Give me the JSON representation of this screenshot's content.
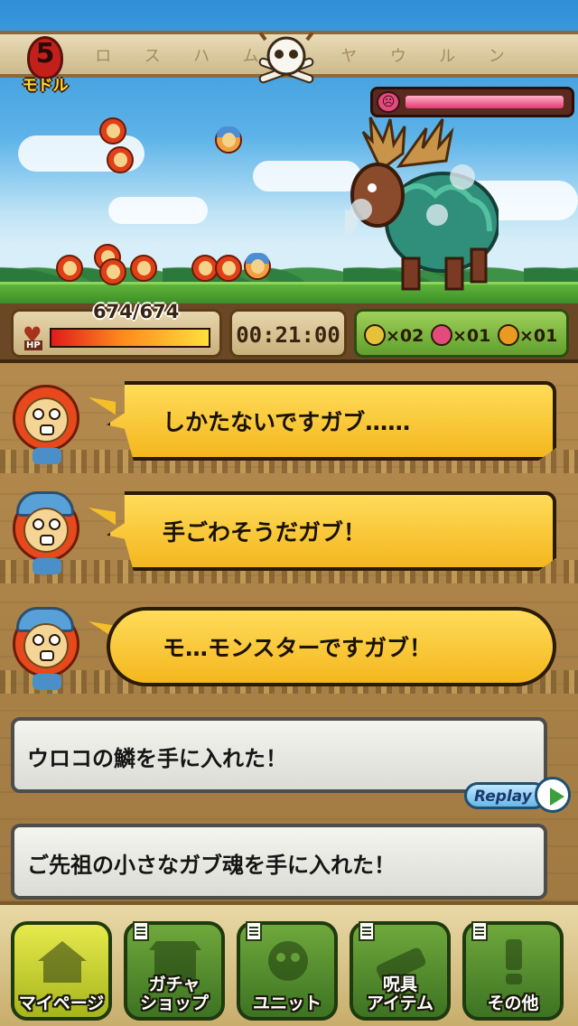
{
  "header": {
    "back_number": "5",
    "back_label": "モドル",
    "banner_glyphs": [
      "ロ",
      "ス",
      "ハ",
      "ム",
      "ユ",
      "ヤ",
      "ウ",
      "ル",
      "ン"
    ]
  },
  "boss": {
    "hp_fraction": 0.96,
    "hp_color": "#e33a72"
  },
  "status": {
    "hp_text": "674/674",
    "hp_label": "HP",
    "hp_fraction": 1.0,
    "timer": "00:21:00",
    "drops": [
      {
        "icon": "gold-skull-icon",
        "count": "×02",
        "color": "#e6c23a"
      },
      {
        "icon": "pink-demon-icon",
        "count": "×01",
        "color": "#e54a7d"
      },
      {
        "icon": "orange-skull-icon",
        "count": "×01",
        "color": "#e89a22"
      }
    ]
  },
  "messages": [
    {
      "text": "しかたないですガブ……",
      "style": "jag"
    },
    {
      "text": "手ごわそうだガブ！",
      "style": "jag"
    },
    {
      "text": "モ…モンスターですガブ！",
      "style": "round"
    }
  ],
  "items": [
    {
      "text": "ウロコの鱗を手に入れた！",
      "replay": "Replay"
    },
    {
      "text": "ご先祖の小さなガブ魂を手に入れた！",
      "replay": "Replay"
    }
  ],
  "nav": [
    {
      "label_lines": [
        "マイページ"
      ],
      "icon": "house-icon",
      "active": true
    },
    {
      "label_lines": [
        "ガチャ",
        "ショップ"
      ],
      "icon": "shop-icon",
      "active": false
    },
    {
      "label_lines": [
        "ユニット"
      ],
      "icon": "unit-icon",
      "active": false
    },
    {
      "label_lines": [
        "呪具",
        "アイテム"
      ],
      "icon": "item-icon",
      "active": false
    },
    {
      "label_lines": [
        "その他"
      ],
      "icon": "other-icon",
      "active": false
    }
  ]
}
